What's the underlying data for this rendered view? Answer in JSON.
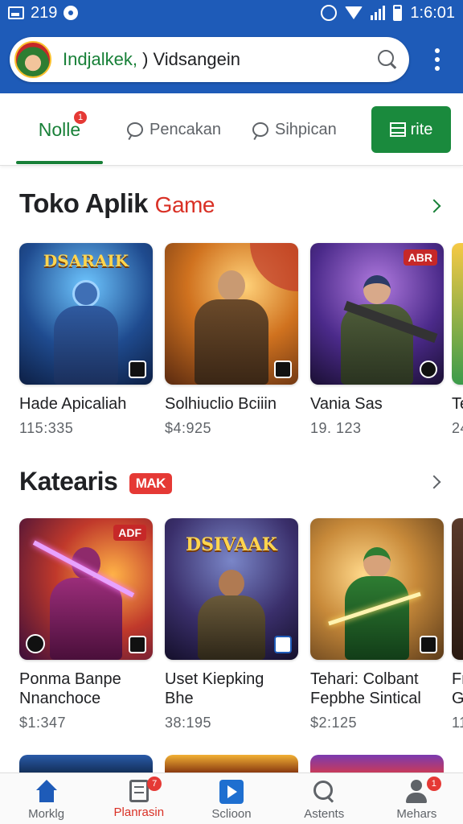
{
  "status_bar": {
    "time_left": "219",
    "clock": "1:6:01"
  },
  "search": {
    "text_accent": "Indjalkek,",
    "text_rest": ") Vidsangein",
    "icon": "search-icon"
  },
  "tabs": {
    "home": {
      "label": "Nolle",
      "badge": "1"
    },
    "search_a": {
      "label": "Pencakan"
    },
    "search_b": {
      "label": "Sihpican"
    },
    "filter": {
      "label": "rite"
    }
  },
  "sections": {
    "store": {
      "title_main": "Toko Aplik",
      "title_accent": "Game"
    },
    "category": {
      "title_main": "Katearis",
      "tag": "MAK"
    }
  },
  "row1": [
    {
      "title": "Hade Apicaliah",
      "price": "115:335",
      "logo": "DSARAIK",
      "badge": ""
    },
    {
      "title": "Solhiuclio Bciiin",
      "price": "$4:925",
      "logo": "",
      "badge": ""
    },
    {
      "title": "Vania Sas",
      "price": "19. 123",
      "logo": "",
      "badge": "ABR"
    },
    {
      "title": "Te",
      "price": "24",
      "logo": "",
      "badge": ""
    }
  ],
  "row2": [
    {
      "title_line1": "Ponma Banpe",
      "title_line2": "Nnanchoce",
      "price": "$1:347",
      "badge": "ADF",
      "logo": ""
    },
    {
      "title_line1": "Uset Kiepking",
      "title_line2": "Bhe",
      "price": "38:195",
      "badge": "",
      "logo": "DSIVAAK"
    },
    {
      "title_line1": "Tehari: Colbant",
      "title_line2": "Fepbhe Sintical",
      "price": "$2:125",
      "badge": "",
      "logo": ""
    },
    {
      "title_line1": "Fr",
      "title_line2": "G",
      "price": "11",
      "badge": "",
      "logo": ""
    }
  ],
  "bottom_nav": [
    {
      "label": "Morklg",
      "icon": "home-icon",
      "badge": ""
    },
    {
      "label": "Planrasin",
      "icon": "document-icon",
      "badge": "7"
    },
    {
      "label": "Sclioon",
      "icon": "play-icon",
      "badge": ""
    },
    {
      "label": "Astents",
      "icon": "search-icon",
      "badge": ""
    },
    {
      "label": "Mehars",
      "icon": "person-icon",
      "badge": "1"
    }
  ],
  "colors": {
    "brand_blue": "#1e5bb8",
    "accent_green": "#188038",
    "accent_red": "#d93025"
  }
}
